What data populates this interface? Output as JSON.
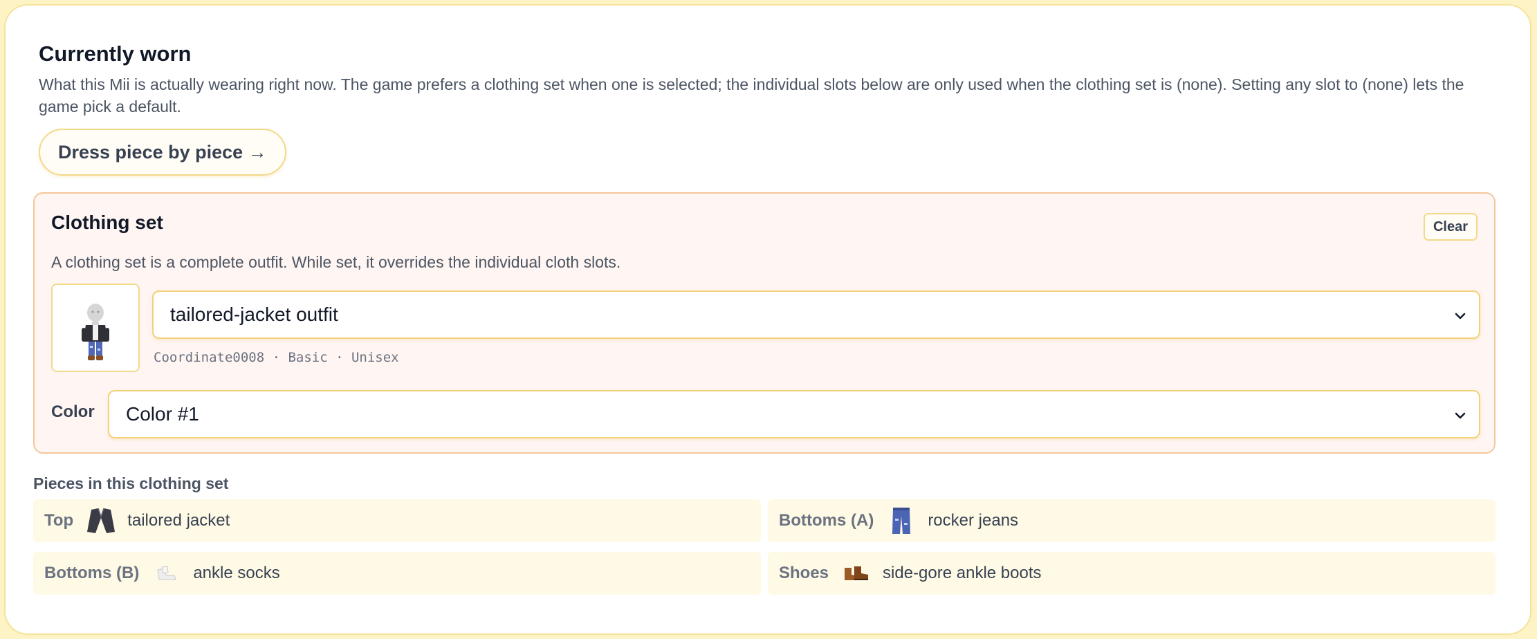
{
  "header": {
    "title": "Currently worn",
    "description": "What this Mii is actually wearing right now. The game prefers a clothing set when one is selected; the individual slots below are only used when the clothing set is (none). Setting any slot to (none) lets the game pick a default.",
    "dress_button_label": "Dress piece by piece →"
  },
  "clothing_set": {
    "title": "Clothing set",
    "clear_label": "Clear",
    "description": "A clothing set is a complete outfit. While set, it overrides the individual cloth slots.",
    "selected_outfit": "tailored-jacket outfit",
    "code_line": "Coordinate0008 · Basic · Unisex",
    "color_label": "Color",
    "selected_color": "Color #1"
  },
  "pieces": {
    "title": "Pieces in this clothing set",
    "items": [
      {
        "slot": "Top",
        "name": "tailored jacket",
        "icon": "jacket-icon"
      },
      {
        "slot": "Bottoms (A)",
        "name": "rocker jeans",
        "icon": "jeans-icon"
      },
      {
        "slot": "Bottoms (B)",
        "name": "ankle socks",
        "icon": "socks-icon"
      },
      {
        "slot": "Shoes",
        "name": "side-gore ankle boots",
        "icon": "boots-icon"
      }
    ]
  },
  "colors": {
    "accent_border": "#f3d98a",
    "set_panel_bg": "#fff5f2",
    "piece_row_bg": "#fffae6"
  }
}
